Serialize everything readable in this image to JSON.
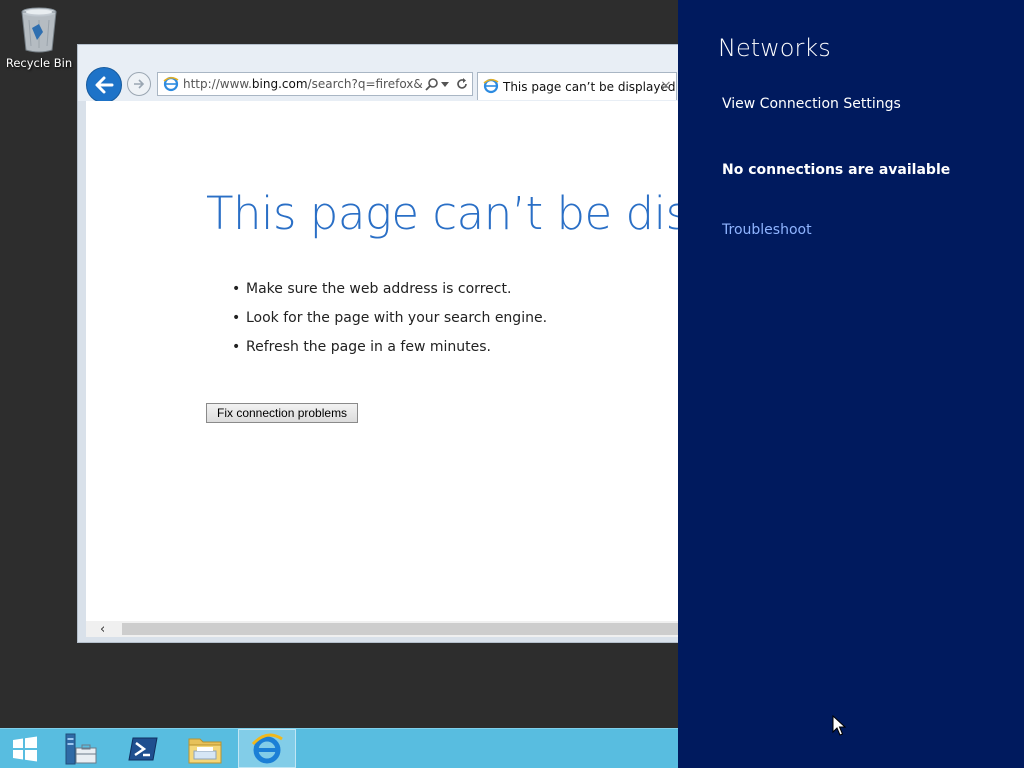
{
  "desktop": {
    "recycle_bin_label": "Recycle Bin"
  },
  "browser": {
    "address": {
      "prefix": "http://www.",
      "domain": "bing.com",
      "path": "/search?q=firefox&src="
    },
    "tab_title": "This page can’t be displayed",
    "tab_close": "×",
    "error_title": "This page can’t be displayed",
    "suggestions": [
      "Make sure the web address is correct.",
      "Look for the page with your search engine.",
      "Refresh the page in a few minutes."
    ],
    "bullet": "•",
    "fix_button": "Fix connection problems",
    "scroll_left_glyph": "‹"
  },
  "networks_panel": {
    "title": "Networks",
    "view_settings": "View Connection Settings",
    "status": "No connections are available",
    "troubleshoot": "Troubleshoot"
  },
  "taskbar": {
    "items": [
      "start-button",
      "server-manager",
      "powershell",
      "file-explorer",
      "internet-explorer"
    ],
    "active": "internet-explorer"
  },
  "colors": {
    "panel_bg": "#001a5e",
    "taskbar_bg": "#58bde0",
    "error_title": "#2a6fc6",
    "link": "#8fb4ff"
  }
}
